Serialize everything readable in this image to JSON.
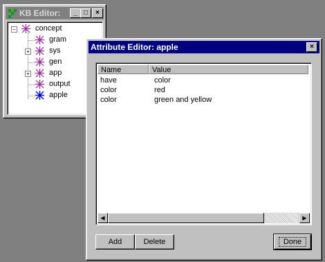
{
  "kb_editor": {
    "title": "KB Editor:",
    "tree": [
      {
        "label": "concept",
        "icon": "concept-icon",
        "expander": "−"
      },
      {
        "label": "gram",
        "icon": "concept-icon"
      },
      {
        "label": "sys",
        "icon": "concept-icon",
        "expander": "+"
      },
      {
        "label": "gen",
        "icon": "concept-icon"
      },
      {
        "label": "app",
        "icon": "concept-icon",
        "expander": "+"
      },
      {
        "label": "output",
        "icon": "concept-icon"
      },
      {
        "label": "apple",
        "icon": "instance-icon"
      }
    ],
    "buttons": {
      "minimize": "_",
      "maximize": "□",
      "close": "×"
    }
  },
  "attribute_editor": {
    "title": "Attribute Editor: apple",
    "close": "×",
    "columns": [
      "Name",
      "Value"
    ],
    "rows": [
      {
        "name": "have",
        "value": "color"
      },
      {
        "name": "color",
        "value": "red"
      },
      {
        "name": "color",
        "value": "green and yellow"
      }
    ],
    "buttons": {
      "add": "Add",
      "delete": "Delete",
      "done": "Done"
    }
  },
  "colors": {
    "desktop": "#808080",
    "active_title": "#000080",
    "inactive_title": "#808080",
    "concept_icon": "#a020a0",
    "instance_icon": "#0000ff"
  }
}
